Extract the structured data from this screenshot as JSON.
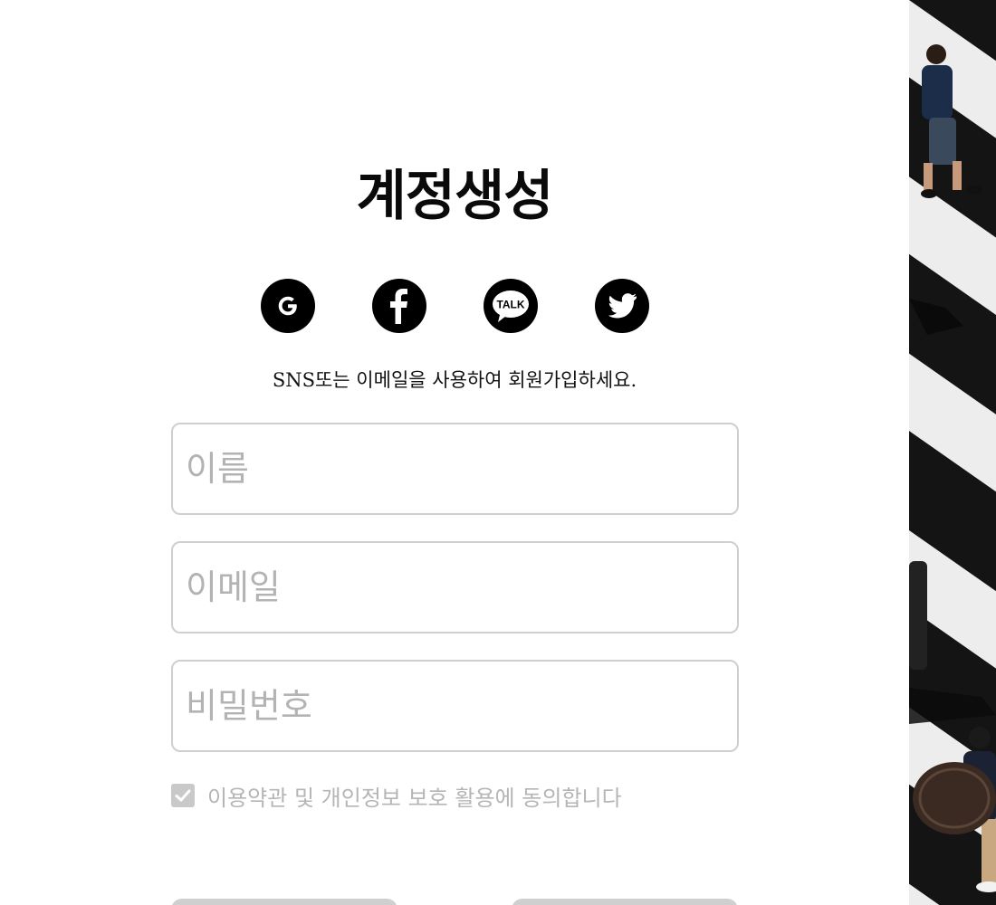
{
  "page": {
    "title": "계정생성",
    "subtitle": "SNS또는 이메일을 사용하여 회원가입하세요."
  },
  "social": [
    {
      "name": "google",
      "icon": "google-icon"
    },
    {
      "name": "facebook",
      "icon": "facebook-icon"
    },
    {
      "name": "kakaotalk",
      "icon": "kakaotalk-icon",
      "text": "TALK"
    },
    {
      "name": "twitter",
      "icon": "twitter-icon"
    }
  ],
  "form": {
    "name_placeholder": "이름",
    "email_placeholder": "이메일",
    "password_placeholder": "비밀번호",
    "name_value": "",
    "email_value": "",
    "password_value": ""
  },
  "agreement": {
    "label": "이용약관 및 개인정보 보호 활용에 동의합니다",
    "checked": true
  },
  "colors": {
    "social_bg": "#000000",
    "field_border": "#cfcfcf",
    "placeholder": "#b3b3b3",
    "checkbox": "#c9c9c9",
    "button_bg": "#cfcfcf"
  },
  "photo": {
    "icon": "crosswalk-photo"
  }
}
